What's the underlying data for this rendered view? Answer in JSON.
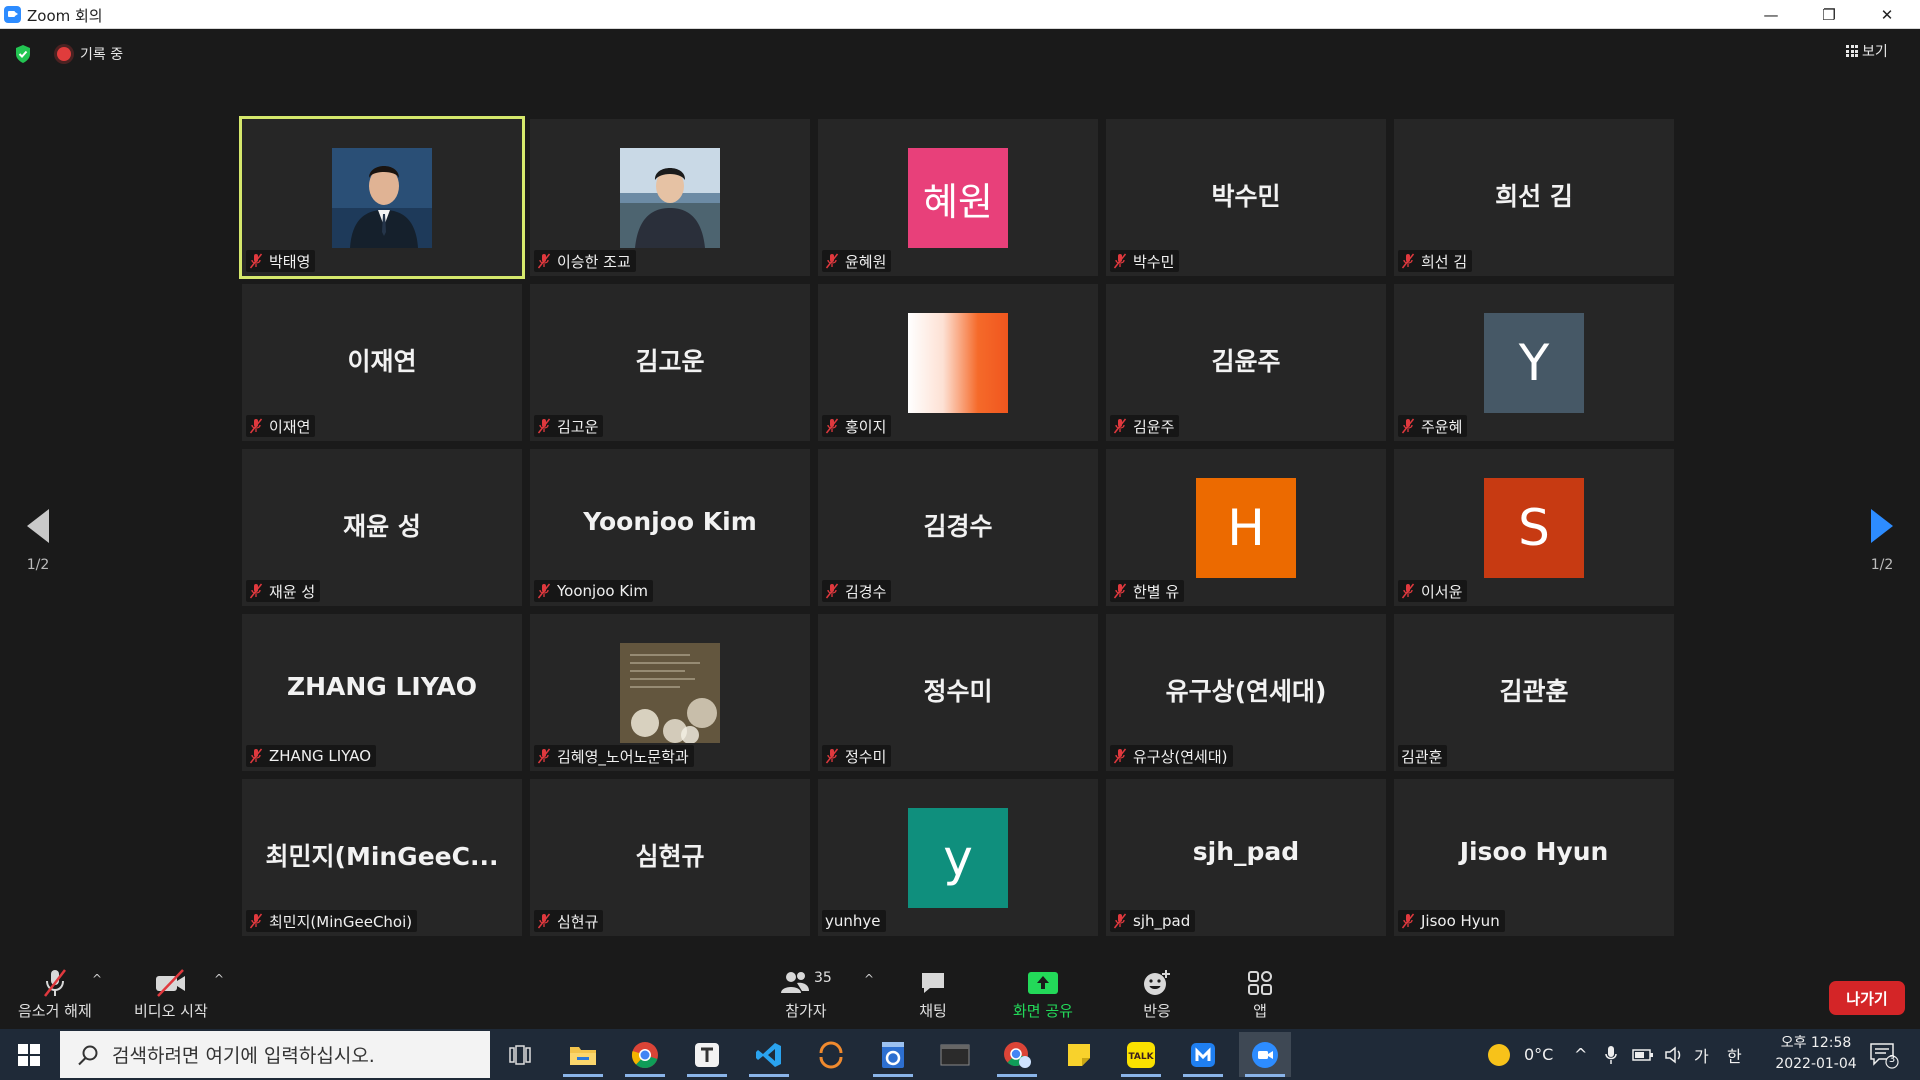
{
  "window": {
    "title": "Zoom 회의",
    "minimize_glyph": "—",
    "restore_glyph": "❐",
    "close_glyph": "✕"
  },
  "meeting": {
    "recording_label": "기록 중",
    "view_label": "보기",
    "page_prev": "1/2",
    "page_next": "1/2"
  },
  "tiles": [
    {
      "display": "photo",
      "photo": "man-suit",
      "name": "박태영",
      "muted": true,
      "active": true
    },
    {
      "display": "photo",
      "photo": "man-outdoor",
      "name": "이승한 조교",
      "muted": true
    },
    {
      "display": "avatar",
      "avatar_text": "혜원",
      "avatar_color": "#e8407a",
      "avatar_font": 38,
      "name": "윤혜원",
      "muted": true
    },
    {
      "display": "text",
      "big_text": "박수민",
      "name": "박수민",
      "muted": true
    },
    {
      "display": "text",
      "big_text": "희선 김",
      "name": "희선 김",
      "muted": true
    },
    {
      "display": "text",
      "big_text": "이재연",
      "name": "이재연",
      "muted": true
    },
    {
      "display": "text",
      "big_text": "김고운",
      "name": "김고운",
      "muted": true
    },
    {
      "display": "gradient",
      "name": "홍이지",
      "muted": true
    },
    {
      "display": "text",
      "big_text": "김윤주",
      "name": "김윤주",
      "muted": true
    },
    {
      "display": "avatar",
      "avatar_text": "Y",
      "avatar_color": "#465866",
      "avatar_font": 50,
      "name": "주윤혜",
      "muted": true
    },
    {
      "display": "text",
      "big_text": "재윤 성",
      "name": "재윤 성",
      "muted": true
    },
    {
      "display": "text",
      "big_text": "Yoonjoo Kim",
      "name": "Yoonjoo Kim",
      "muted": true
    },
    {
      "display": "text",
      "big_text": "김경수",
      "name": "김경수",
      "muted": true
    },
    {
      "display": "avatar",
      "avatar_text": "H",
      "avatar_color": "#ec6a00",
      "avatar_font": 50,
      "name": "한별 유",
      "muted": true
    },
    {
      "display": "avatar",
      "avatar_text": "S",
      "avatar_color": "#c73a12",
      "avatar_font": 50,
      "name": "이서윤",
      "muted": true
    },
    {
      "display": "text",
      "big_text": "ZHANG LIYAO",
      "name": "ZHANG LIYAO",
      "muted": true
    },
    {
      "display": "photo",
      "photo": "book-page",
      "name": "김혜영_노어노문학과",
      "muted": true
    },
    {
      "display": "text",
      "big_text": "정수미",
      "name": "정수미",
      "muted": true
    },
    {
      "display": "text",
      "big_text": "유구상(연세대)",
      "name": "유구상(연세대)",
      "muted": true
    },
    {
      "display": "text",
      "big_text": "김관훈",
      "name": "김관훈",
      "muted": false
    },
    {
      "display": "text",
      "big_text": "최민지(MinGeeC...",
      "name": "최민지(MinGeeChoi)",
      "muted": true
    },
    {
      "display": "text",
      "big_text": "심현규",
      "name": "심현규",
      "muted": true
    },
    {
      "display": "avatar",
      "avatar_text": "y",
      "avatar_color": "#0f8f7d",
      "avatar_font": 50,
      "name": "yunhye",
      "muted": false
    },
    {
      "display": "text",
      "big_text": "sjh_pad",
      "name": "sjh_pad",
      "muted": true
    },
    {
      "display": "text",
      "big_text": "Jisoo Hyun",
      "name": "Jisoo Hyun",
      "muted": true
    }
  ],
  "toolbar": {
    "unmute_label": "음소거 해제",
    "video_label": "비디오 시작",
    "participants_label": "참가자",
    "participants_count": "35",
    "chat_label": "채팅",
    "share_label": "화면 공유",
    "reactions_label": "반응",
    "apps_label": "앱",
    "leave_label": "나가기",
    "caret": "^"
  },
  "taskbar": {
    "search_placeholder": "검색하려면 여기에 입력하십시오.",
    "weather": "0°C",
    "ime_ga": "가",
    "ime_han": "한",
    "time": "오후 12:58",
    "date": "2022-01-04",
    "notifications": "3",
    "tray_up": "^"
  },
  "colors": {
    "accent_blue": "#2d8cff",
    "active_speaker": "#d5e86c",
    "mute_red": "#e0393e",
    "share_green": "#23d959",
    "leave_red": "#d42527"
  }
}
